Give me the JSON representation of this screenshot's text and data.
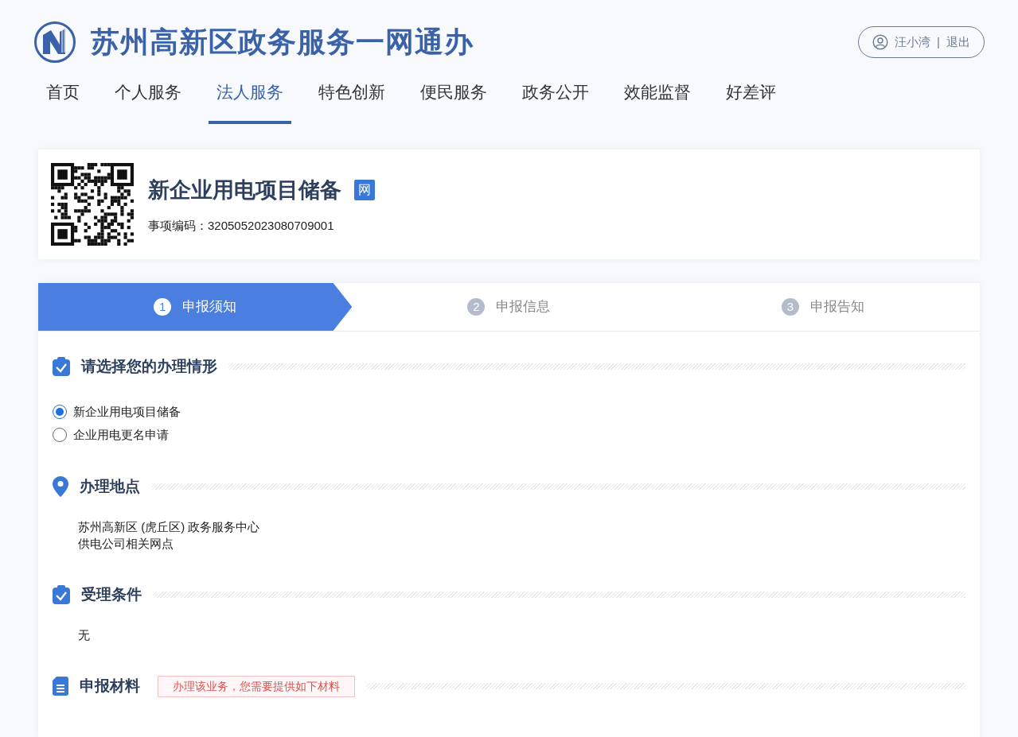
{
  "header": {
    "title": "苏州高新区政务服务一网通办",
    "user": {
      "name": "汪小湾",
      "separator": "|",
      "logout": "退出"
    }
  },
  "nav": [
    {
      "label": "首页",
      "selected": false
    },
    {
      "label": "个人服务",
      "selected": false
    },
    {
      "label": "法人服务",
      "selected": true
    },
    {
      "label": "特色创新",
      "selected": false
    },
    {
      "label": "便民服务",
      "selected": false
    },
    {
      "label": "政务公开",
      "selected": false
    },
    {
      "label": "效能监督",
      "selected": false
    },
    {
      "label": "好差评",
      "selected": false
    }
  ],
  "item": {
    "title": "新企业用电项目储备",
    "badge": "网",
    "code_label": "事项编码：",
    "code": "3205052023080709001"
  },
  "steps": [
    {
      "number": "1",
      "label": "申报须知",
      "selected": true
    },
    {
      "number": "2",
      "label": "申报信息",
      "selected": false
    },
    {
      "number": "3",
      "label": "申报告知",
      "selected": false
    }
  ],
  "sections": [
    {
      "kind": "checklist",
      "title": "请选择您的办理情形",
      "options": [
        {
          "label": "新企业用电项目储备",
          "selected": true
        },
        {
          "label": "企业用电更名申请",
          "selected": false
        }
      ]
    },
    {
      "kind": "location",
      "title": "办理地点",
      "lines": [
        "苏州高新区 (虎丘区) 政务服务中心",
        "供电公司相关网点"
      ]
    },
    {
      "kind": "checklist",
      "title": "受理条件",
      "lines": [
        "无"
      ]
    },
    {
      "kind": "document",
      "title": "申报材料",
      "note": "办理该业务，您需要提供如下材料"
    }
  ]
}
